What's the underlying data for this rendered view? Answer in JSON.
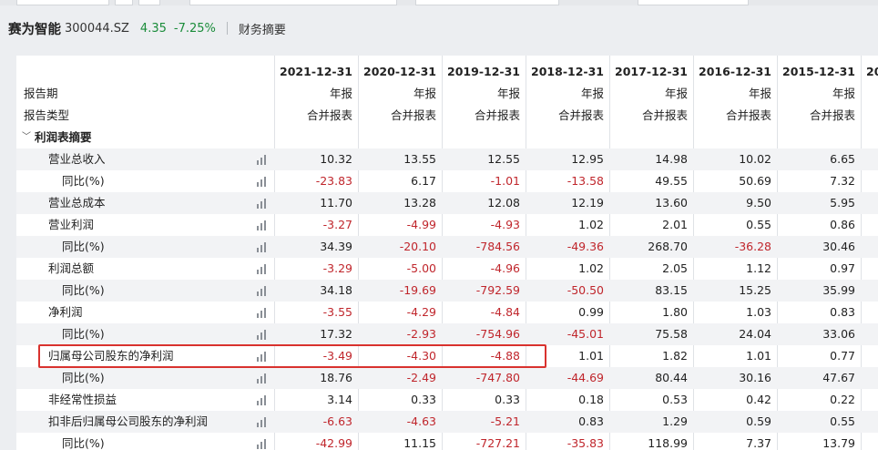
{
  "header": {
    "name": "赛为智能",
    "code": "300044.SZ",
    "price": "4.35",
    "change": "-7.25%",
    "tab": "财务摘要"
  },
  "table": {
    "row_labels": {
      "period": "报告期",
      "type": "报告类型",
      "section": "利润表摘要"
    },
    "columns": [
      {
        "date": "2021-12-31",
        "period": "年报",
        "type": "合并报表"
      },
      {
        "date": "2020-12-31",
        "period": "年报",
        "type": "合并报表"
      },
      {
        "date": "2019-12-31",
        "period": "年报",
        "type": "合并报表"
      },
      {
        "date": "2018-12-31",
        "period": "年报",
        "type": "合并报表"
      },
      {
        "date": "2017-12-31",
        "period": "年报",
        "type": "合并报表"
      },
      {
        "date": "2016-12-31",
        "period": "年报",
        "type": "合并报表"
      },
      {
        "date": "2015-12-31",
        "period": "年报",
        "type": "合并报表"
      },
      {
        "date": "20"
      }
    ],
    "rows": [
      {
        "label": "营业总收入",
        "level": 1,
        "values": [
          "10.32",
          "13.55",
          "12.55",
          "12.95",
          "14.98",
          "10.02",
          "6.65"
        ]
      },
      {
        "label": "同比(%)",
        "level": 2,
        "values": [
          "-23.83",
          "6.17",
          "-1.01",
          "-13.58",
          "49.55",
          "50.69",
          "7.32"
        ]
      },
      {
        "label": "营业总成本",
        "level": 1,
        "values": [
          "11.70",
          "13.28",
          "12.08",
          "12.19",
          "13.60",
          "9.50",
          "5.95"
        ]
      },
      {
        "label": "营业利润",
        "level": 1,
        "values": [
          "-3.27",
          "-4.99",
          "-4.93",
          "1.02",
          "2.01",
          "0.55",
          "0.86"
        ]
      },
      {
        "label": "同比(%)",
        "level": 2,
        "values": [
          "34.39",
          "-20.10",
          "-784.56",
          "-49.36",
          "268.70",
          "-36.28",
          "30.46"
        ]
      },
      {
        "label": "利润总额",
        "level": 1,
        "values": [
          "-3.29",
          "-5.00",
          "-4.96",
          "1.02",
          "2.05",
          "1.12",
          "0.97"
        ]
      },
      {
        "label": "同比(%)",
        "level": 2,
        "values": [
          "34.18",
          "-19.69",
          "-792.59",
          "-50.50",
          "83.15",
          "15.25",
          "35.99"
        ]
      },
      {
        "label": "净利润",
        "level": 1,
        "values": [
          "-3.55",
          "-4.29",
          "-4.84",
          "0.99",
          "1.80",
          "1.03",
          "0.83"
        ]
      },
      {
        "label": "同比(%)",
        "level": 2,
        "values": [
          "17.32",
          "-2.93",
          "-754.96",
          "-45.01",
          "75.58",
          "24.04",
          "33.06"
        ]
      },
      {
        "label": "归属母公司股东的净利润",
        "level": 1,
        "highlight": true,
        "values": [
          "-3.49",
          "-4.30",
          "-4.88",
          "1.01",
          "1.82",
          "1.01",
          "0.77"
        ]
      },
      {
        "label": "同比(%)",
        "level": 2,
        "values": [
          "18.76",
          "-2.49",
          "-747.80",
          "-44.69",
          "80.44",
          "30.16",
          "47.67"
        ]
      },
      {
        "label": "非经常性损益",
        "level": 1,
        "values": [
          "3.14",
          "0.33",
          "0.33",
          "0.18",
          "0.53",
          "0.42",
          "0.22"
        ]
      },
      {
        "label": "扣非后归属母公司股东的净利润",
        "level": 1,
        "values": [
          "-6.63",
          "-4.63",
          "-5.21",
          "0.83",
          "1.29",
          "0.59",
          "0.55"
        ]
      },
      {
        "label": "同比(%)",
        "level": 2,
        "values": [
          "-42.99",
          "11.15",
          "-727.21",
          "-35.83",
          "118.99",
          "7.37",
          "13.79"
        ]
      }
    ]
  },
  "colors": {
    "negative": "#c0262c",
    "positive_quote": "#1a8c3a",
    "highlight": "#d9322e"
  }
}
